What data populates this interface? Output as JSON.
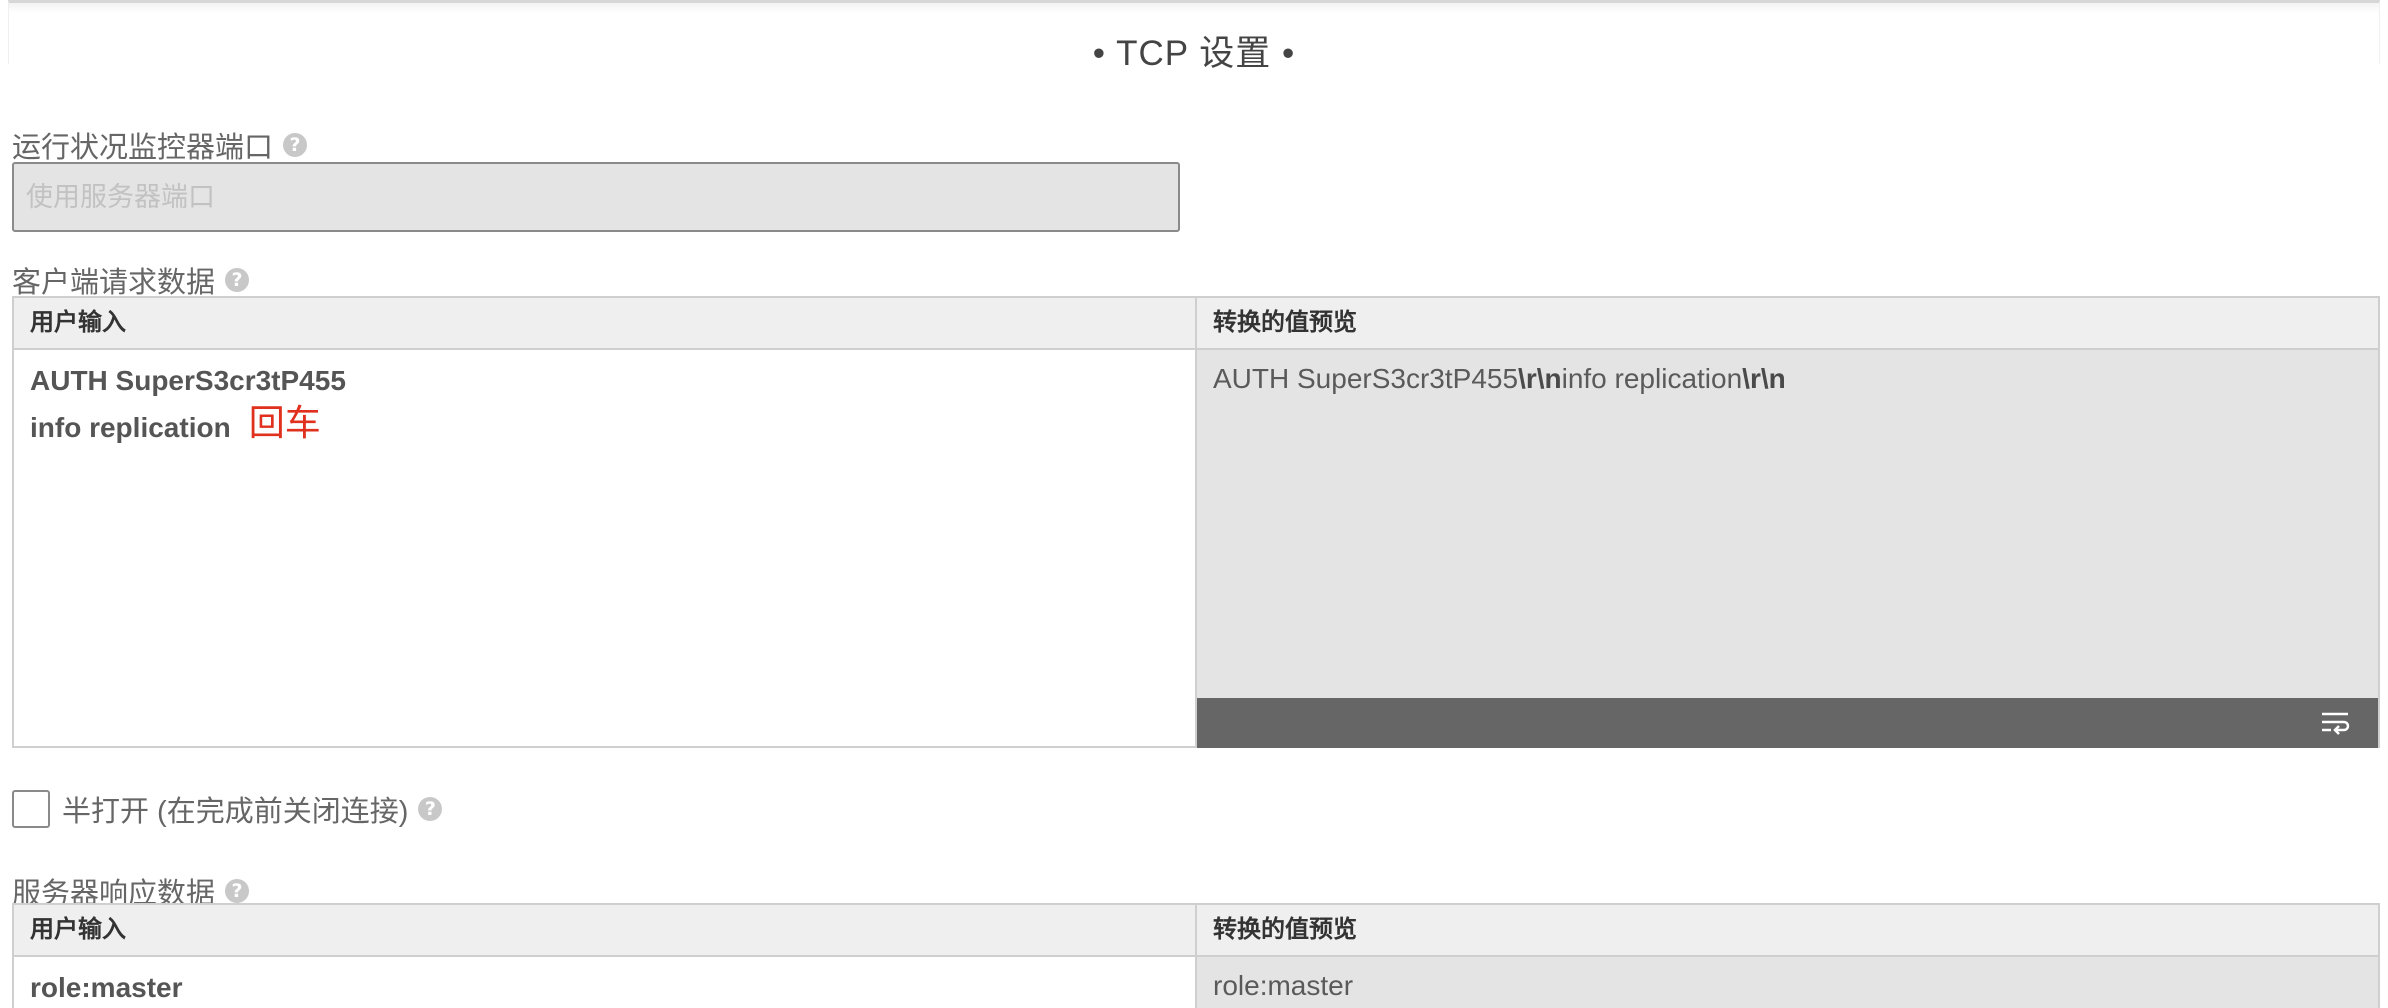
{
  "section_title": "• TCP 设置 •",
  "health_port": {
    "label": "运行状况监控器端口",
    "placeholder": "使用服务器端口"
  },
  "client_request": {
    "label": "客户端请求数据",
    "col_input": "用户输入",
    "col_preview": "转换的值预览",
    "input_lines": [
      "AUTH SuperS3cr3tP455",
      "info replication"
    ],
    "enter_annotation": "回车",
    "preview_parts": [
      "AUTH SuperS3cr3tP455",
      "\\r\\n",
      "info replication",
      "\\r\\n"
    ]
  },
  "half_open": {
    "label": "半打开 (在完成前关闭连接)",
    "checked": false
  },
  "server_response": {
    "label": "服务器响应数据",
    "col_input": "用户输入",
    "col_preview": "转换的值预览",
    "input_value": "role:master",
    "preview_value": "role:master"
  },
  "icons": {
    "help": "question-circle-icon",
    "wrap": "text-wrap-icon"
  },
  "colors": {
    "annotation": "#e0301e",
    "preview_bg": "#e4e4e4",
    "toolbar_bg": "#666666"
  }
}
